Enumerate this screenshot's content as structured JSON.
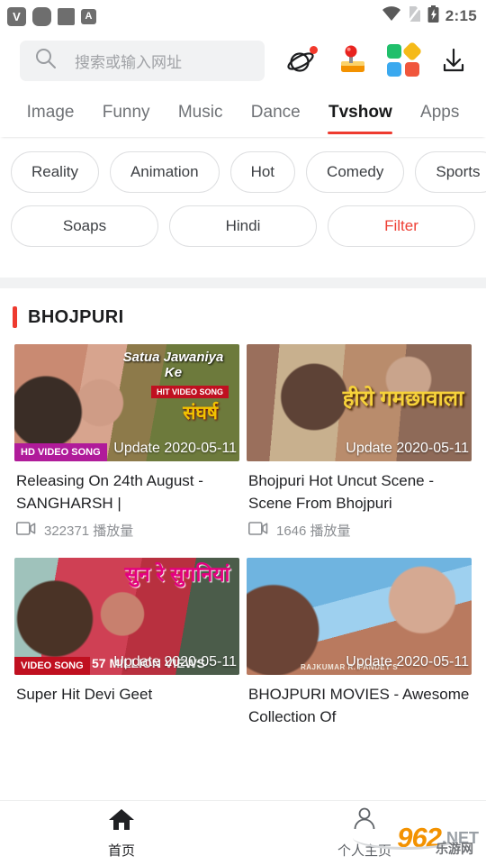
{
  "status_bar": {
    "left_icons": [
      {
        "name": "app-badge-v-icon",
        "glyph": "V"
      },
      {
        "name": "app-badge-rounded-icon",
        "glyph": ""
      },
      {
        "name": "app-badge-square-icon",
        "glyph": ""
      },
      {
        "name": "app-badge-a-icon",
        "glyph": "A"
      }
    ],
    "wifi_icon": "wifi-icon",
    "sim_icon": "no-sim-icon",
    "battery_icon": "battery-charging-icon",
    "time": "2:15"
  },
  "search": {
    "icon": "search-icon",
    "placeholder": "搜索或输入网址",
    "value": ""
  },
  "toolbar": {
    "icons": [
      {
        "name": "planet-icon",
        "badge": true
      },
      {
        "name": "joystick-icon",
        "badge": false
      },
      {
        "name": "apps-grid-icon",
        "badge": false
      },
      {
        "name": "download-icon",
        "badge": false
      }
    ]
  },
  "tabs": {
    "items": [
      {
        "label": "Image",
        "active": false
      },
      {
        "label": "Funny",
        "active": false
      },
      {
        "label": "Music",
        "active": false
      },
      {
        "label": "Dance",
        "active": false
      },
      {
        "label": "Tvshow",
        "active": true
      },
      {
        "label": "Apps",
        "active": false
      }
    ],
    "active_indicator_color": "#ee3a2f"
  },
  "chips": {
    "row1": [
      {
        "label": "Reality",
        "highlight": false
      },
      {
        "label": "Animation",
        "highlight": false
      },
      {
        "label": "Hot",
        "highlight": false
      },
      {
        "label": "Comedy",
        "highlight": false
      },
      {
        "label": "Sports",
        "highlight": false
      }
    ],
    "row2": [
      {
        "label": "Soaps",
        "highlight": false
      },
      {
        "label": "Hindi",
        "highlight": false
      },
      {
        "label": "Filter",
        "highlight": true
      }
    ],
    "highlight_color": "#ee4136"
  },
  "section": {
    "accent_color": "#ee3a2f",
    "title": "BHOJPURI"
  },
  "videos": [
    {
      "title": "Releasing On 24th August - SANGHARSH |",
      "views": "322371 播放量",
      "date_overlay": "Update 2020-05-11",
      "badge": "HD VIDEO SONG",
      "thumb_title": "Satua Jawaniya Ke",
      "thumb_sub": "HIT VIDEO SONG",
      "thumb_hindi": "संघर्ष"
    },
    {
      "title": "Bhojpuri Hot Uncut Scene - Scene From Bhojpuri",
      "views": "1646 播放量",
      "date_overlay": "Update 2020-05-11",
      "badge": "",
      "thumb_hindi": "हीरो गमछावाला"
    },
    {
      "title": "Super Hit Devi Geet",
      "views": "",
      "date_overlay": "Update 2020-05-11",
      "badge": "VIDEO SONG",
      "thumb_hindi": "सुन रे सुगनियां",
      "thumb_views": "57 MILLION VIEWS"
    },
    {
      "title": "BHOJPURI MOVIES - Awesome Collection Of",
      "views": "",
      "date_overlay": "Update 2020-05-11",
      "badge": "",
      "thumb_credit": "RAJKUMAR R. PANDEY'S"
    }
  ],
  "bottom_nav": {
    "items": [
      {
        "label": "首页",
        "icon": "home-icon",
        "active": true
      },
      {
        "label": "个人主页",
        "icon": "person-icon",
        "active": false
      }
    ]
  },
  "watermark": {
    "number": "962",
    "tld": ".NET",
    "chinese": "乐游网"
  }
}
